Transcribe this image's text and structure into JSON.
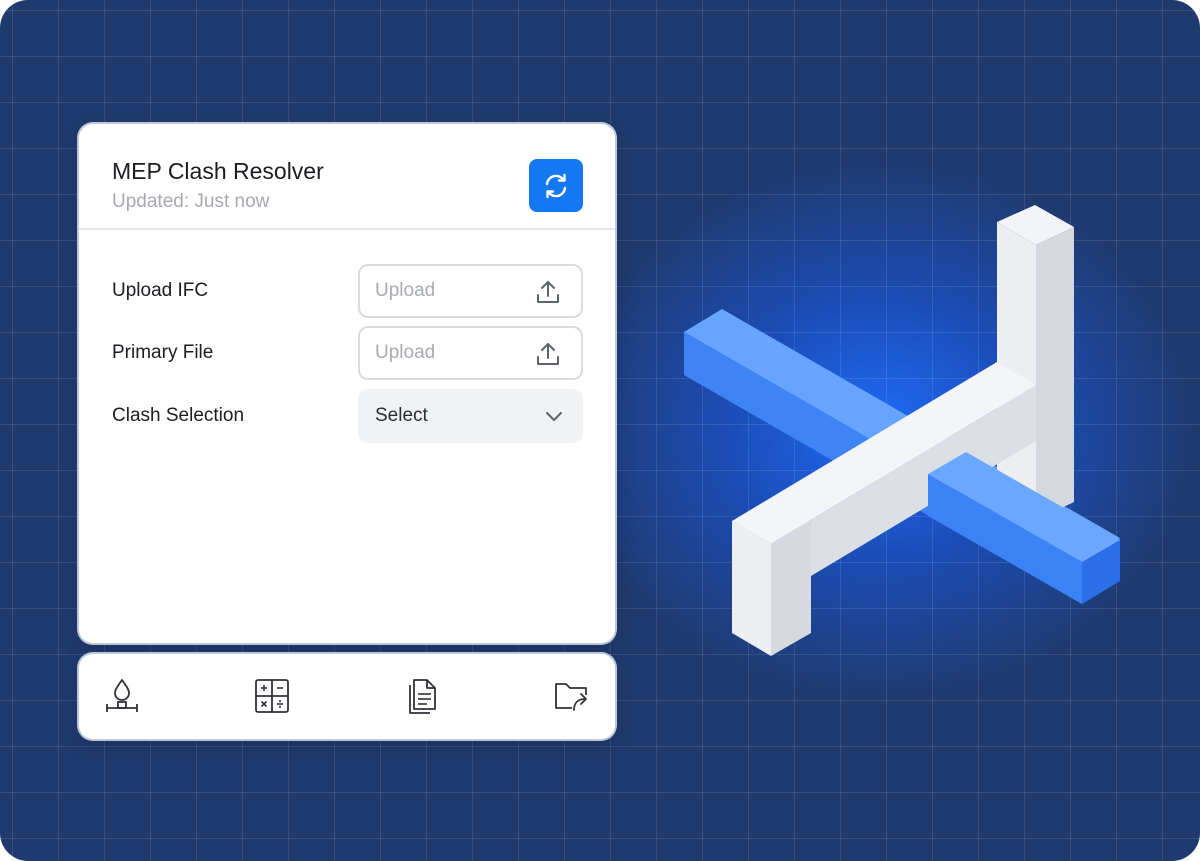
{
  "panel": {
    "title": "MEP Clash Resolver",
    "subtitle": "Updated: Just now",
    "refresh_icon": "refresh-icon",
    "accent_color": "#1478f2"
  },
  "form": {
    "rows": [
      {
        "label": "Upload IFC",
        "placeholder": "Upload",
        "icon": "upload-icon"
      },
      {
        "label": "Primary File",
        "placeholder": "Upload",
        "icon": "upload-icon"
      },
      {
        "label": "Clash Selection",
        "value": "Select",
        "icon": "chevron-down-icon"
      }
    ]
  },
  "toolbar": {
    "items": [
      "water-valve-icon",
      "calculator-icon",
      "document-icon",
      "folder-share-icon"
    ]
  },
  "background": {
    "base_color": "#1f3a6e",
    "glow_color": "#1e6eff",
    "illustration": "isometric-pipe-clash"
  }
}
